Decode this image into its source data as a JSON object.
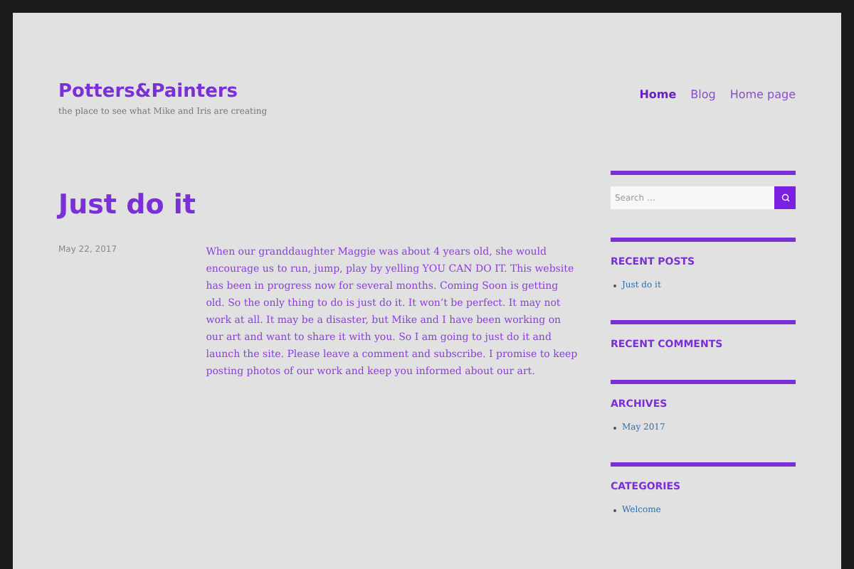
{
  "site": {
    "title": "Potters&Painters",
    "tagline": "the place to see what Mike and Iris are creating"
  },
  "nav": [
    {
      "label": "Home",
      "selected": true
    },
    {
      "label": "Blog",
      "selected": false
    },
    {
      "label": "Home page",
      "selected": false
    }
  ],
  "post": {
    "title": "Just do it",
    "date": "May 22, 2017",
    "body": "When our granddaughter Maggie was about 4 years old, she would encourage us to run, jump, play by yelling YOU CAN DO IT. This website has been in progress now for several months. Coming Soon is getting old. So the only thing to do is just do it. It won’t be perfect. It may not work at all. It may be a disaster, but Mike and I have been working on our art and want to share it with you. So I am going to just do it and launch the site. Please leave a comment and subscribe. I promise to keep posting photos of our work and keep you informed about our art."
  },
  "sidebar": [
    {
      "kind": "search",
      "placeholder": "Search …"
    },
    {
      "kind": "list",
      "heading": "RECENT POSTS",
      "items": [
        "Just do it"
      ]
    },
    {
      "kind": "list",
      "heading": "RECENT COMMENTS"
    },
    {
      "kind": "list",
      "heading": "ARCHIVES",
      "items": [
        "May 2017"
      ]
    },
    {
      "kind": "list",
      "heading": "CATEGORIES",
      "items": [
        "Welcome"
      ]
    }
  ]
}
